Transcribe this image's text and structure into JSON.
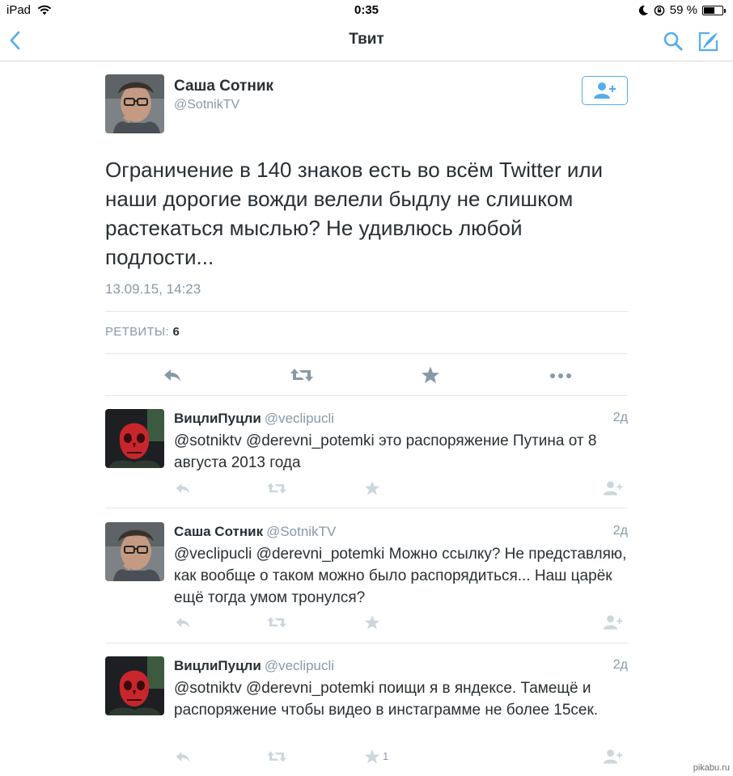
{
  "status_bar": {
    "device": "iPad",
    "time": "0:35",
    "battery": "59 %",
    "battery_level": 0.59
  },
  "nav": {
    "title": "Твит"
  },
  "tweet": {
    "author_name": "Саша Сотник",
    "author_handle": "@SotnikTV",
    "text": "Ограничение в 140 знаков есть во всём Twitter или наши дорогие вожди велели быдлу не слишком растекаться мыслью? Не удивлюсь любой подлости...",
    "date": "13.09.15, 14:23",
    "retweets_label": "РЕТВИТЫ:",
    "retweets_count": "6"
  },
  "replies": [
    {
      "name": "ВицлиПуцли",
      "handle": "@veclipucli",
      "time": "2д",
      "text": "@sotniktv @derevni_potemki это распоряжение Путина от 8 августа 2013 года",
      "favorites": ""
    },
    {
      "name": "Саша Сотник",
      "handle": "@SotnikTV",
      "time": "2д",
      "text": "@veclipucli @derevni_potemki Можно ссылку? Не представляю, как вообще о таком можно было распорядиться... Наш царёк ещё тогда умом тронулся?",
      "favorites": ""
    },
    {
      "name": "ВицлиПуцли",
      "handle": "@veclipucli",
      "time": "2д",
      "text": "@sotniktv @derevni_potemki поищи я в яндексе. Тамещё и распоряжение чтобы видео в инстаграмме не более 15сек.",
      "favorites": "1"
    }
  ],
  "watermark": "pikabu.ru",
  "colors": {
    "accent": "#55acee",
    "text": "#292f33",
    "muted": "#8899a6",
    "icon_muted": "#ccd6dd",
    "divider": "#e1e8ed"
  }
}
